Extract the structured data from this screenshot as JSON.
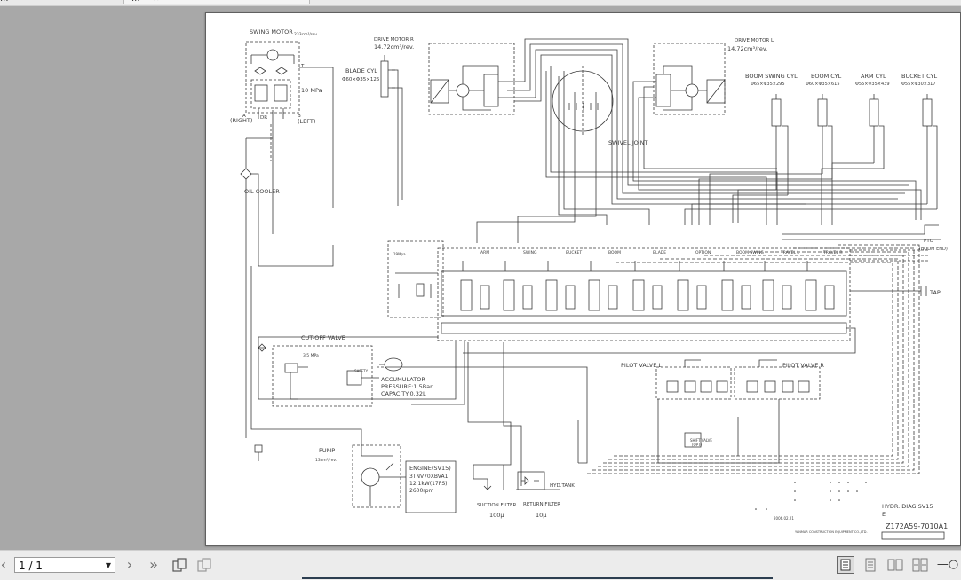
{
  "tabs": [
    {
      "label": "..."
    },
    {
      "label": "...",
      "close": "✕"
    }
  ],
  "diagram": {
    "swing_motor": {
      "title": "SWING MOTOR",
      "spec": "233cm³/rev.",
      "pressure": "10 MPa",
      "port_a": "A",
      "port_a_dir": "(RIGHT)",
      "port_b": "B",
      "port_b_dir": "(LEFT)",
      "port_dr": "DR",
      "port_t": "T"
    },
    "drive_motor_r": {
      "title": "DRIVE MOTOR R",
      "spec": "14.72cm³/rev."
    },
    "drive_motor_l": {
      "title": "DRIVE MOTOR L",
      "spec": "14.72cm³/rev."
    },
    "blade_cyl": {
      "title": "BLADE CYL",
      "spec": "Φ60×Φ35×125"
    },
    "cylinders": [
      {
        "title": "BOOM SWING CYL",
        "spec": "Φ65×Φ35×295"
      },
      {
        "title": "BOOM CYL",
        "spec": "Φ60×Φ35×615"
      },
      {
        "title": "ARM CYL",
        "spec": "Φ55×Φ35×439"
      },
      {
        "title": "BUCKET CYL",
        "spec": "Φ55×Φ30×317"
      }
    ],
    "swivel_joint": "SWIVEL JOINT",
    "oil_cooler": "OIL COOLER",
    "cutoff_valve": {
      "title": "CUT-OFF VALVE",
      "pressure": "3.5 MPa",
      "safety": "SAFETY"
    },
    "accumulator": {
      "title": "ACCUMULATOR",
      "pressure": "PRESSURE:1.5Bar",
      "capacity": "CAPACITY:0.32L"
    },
    "valve_sections": [
      "ARM",
      "SWING",
      "BUCKET",
      "BOOM",
      "BLADE",
      "OPTION",
      "BOOM SWING",
      "TRAVEL L",
      "TRAVEL R"
    ],
    "valve_pressure": "19Mpa",
    "pto": "PTO",
    "pto_sub": "(BOOM END)",
    "tap": "TAP",
    "pilot_valve_l": "PILOT VALVE L",
    "pilot_valve_r": "PILOT VALVE R",
    "shift_valve": "SHIFT VALVE",
    "shift_valve_sub": "(OPT)",
    "pump": {
      "title": "PUMP",
      "spec": "13cm³/rev."
    },
    "engine": {
      "title": "ENGINE(SV15)",
      "model": "3TNV70XBVA1",
      "power": "12.1kW(17PS)",
      "rpm": "2600rpm"
    },
    "suction_filter": {
      "title": "SUCTION FILTER",
      "mesh": "100μ"
    },
    "return_filter": {
      "title": "RETURN FILTER",
      "mesh": "10μ"
    },
    "hyd_tank": "HYD.TANK",
    "title_block": {
      "name": "HYDR. DIAG SV15",
      "name_suffix": "E",
      "drawing_no": "Z172A59-7010A1",
      "company": "YANMAR CONSTRUCTION EQUIPMENT CO.,LTD.",
      "date": "2006.02.21"
    }
  },
  "statusbar": {
    "page_indicator": "1 / 1",
    "zoom_mode": "—○"
  },
  "colors": {
    "line": "#3a3a3a",
    "viewer_bg": "#a8a8a8",
    "page_bg": "#ffffff",
    "toolbar_bg": "#ececec"
  }
}
